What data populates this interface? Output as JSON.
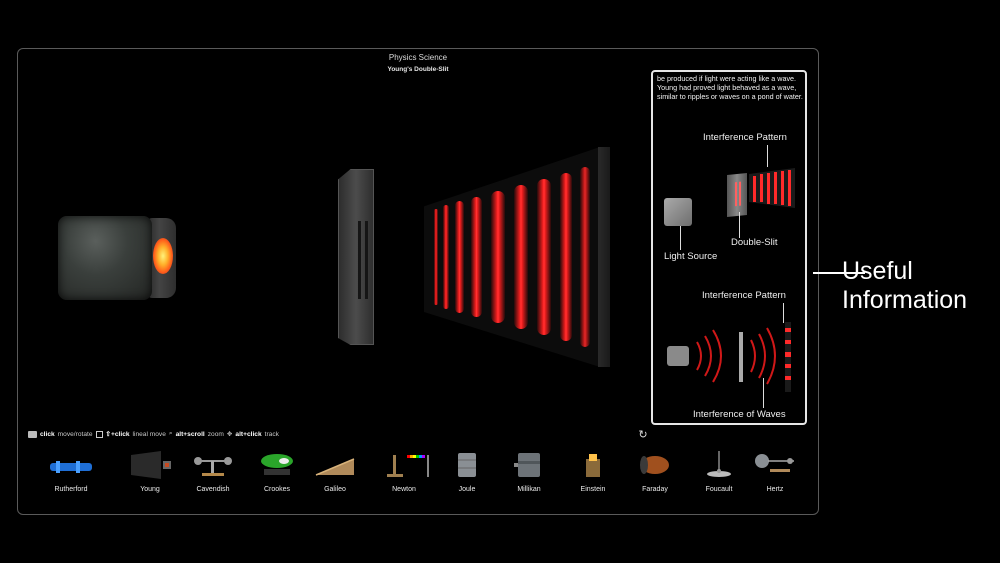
{
  "app": {
    "title": "Physics Science",
    "scene_title": "Young's Double-Slit"
  },
  "info_panel": {
    "text": "be produced if light were acting like a wave. Young had proved light behaved as a wave,  similar to ripples or waves on a pond of water.",
    "labels": {
      "interference_pattern_1": "Interference Pattern",
      "double_slit": "Double-Slit",
      "light_source": "Light Source",
      "interference_pattern_2": "Interference Pattern",
      "interference_of_waves": "Interference of Waves"
    }
  },
  "annotation": {
    "line1": "Useful",
    "line2": "Information"
  },
  "controls": {
    "click": "click",
    "click_desc": "move/rotate",
    "shift_click": "⇧+click",
    "shift_click_desc": "lineal move",
    "alt_scroll": "alt+scroll",
    "alt_scroll_desc": "zoom",
    "alt_click": "alt+click",
    "alt_click_desc": "track",
    "reset_icon": "reset-icon"
  },
  "experiments": [
    {
      "label": "Rutherford",
      "icon": "rutherford-apparatus-icon"
    },
    {
      "label": "Young",
      "icon": "young-double-slit-icon"
    },
    {
      "label": "Cavendish",
      "icon": "cavendish-balance-icon"
    },
    {
      "label": "Crookes",
      "icon": "crookes-tube-icon"
    },
    {
      "label": "Galileo",
      "icon": "galileo-ramp-icon"
    },
    {
      "label": "Newton",
      "icon": "newton-prism-icon"
    },
    {
      "label": "Joule",
      "icon": "joule-apparatus-icon"
    },
    {
      "label": "Millikan",
      "icon": "millikan-oil-drop-icon"
    },
    {
      "label": "Einstein",
      "icon": "einstein-photoelectric-icon"
    },
    {
      "label": "Faraday",
      "icon": "faraday-coil-icon"
    },
    {
      "label": "Foucault",
      "icon": "foucault-pendulum-icon"
    },
    {
      "label": "Hertz",
      "icon": "hertz-apparatus-icon"
    }
  ],
  "colors": {
    "fringe_red": "#ff2020",
    "glow_yellow": "#fff27a",
    "panel_border": "#e6e6e6"
  }
}
